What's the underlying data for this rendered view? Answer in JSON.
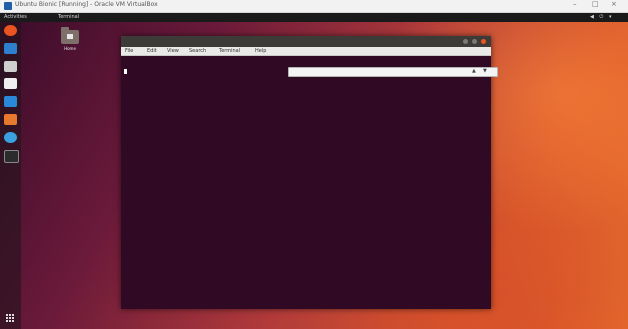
{
  "host": {
    "title": "Ubuntu Bionic [Running] - Oracle VM VirtualBox",
    "controls": [
      "–",
      "□",
      "×"
    ]
  },
  "panel": {
    "activities": "Activities",
    "app": "Terminal",
    "clock": "",
    "status": "◀ ⏻ ▾"
  },
  "desktop": {
    "home_label": "Home"
  },
  "terminal": {
    "title": "",
    "menu": [
      "File",
      "Edit",
      "View",
      "Search",
      "Terminal",
      "Help"
    ],
    "lines": [
      "",
      ""
    ],
    "search_placeholder": ""
  },
  "watermark": {
    "line1": "",
    "line2": ""
  },
  "colors": {
    "terminal_bg": "#300a24",
    "close_button": "#e95420"
  }
}
